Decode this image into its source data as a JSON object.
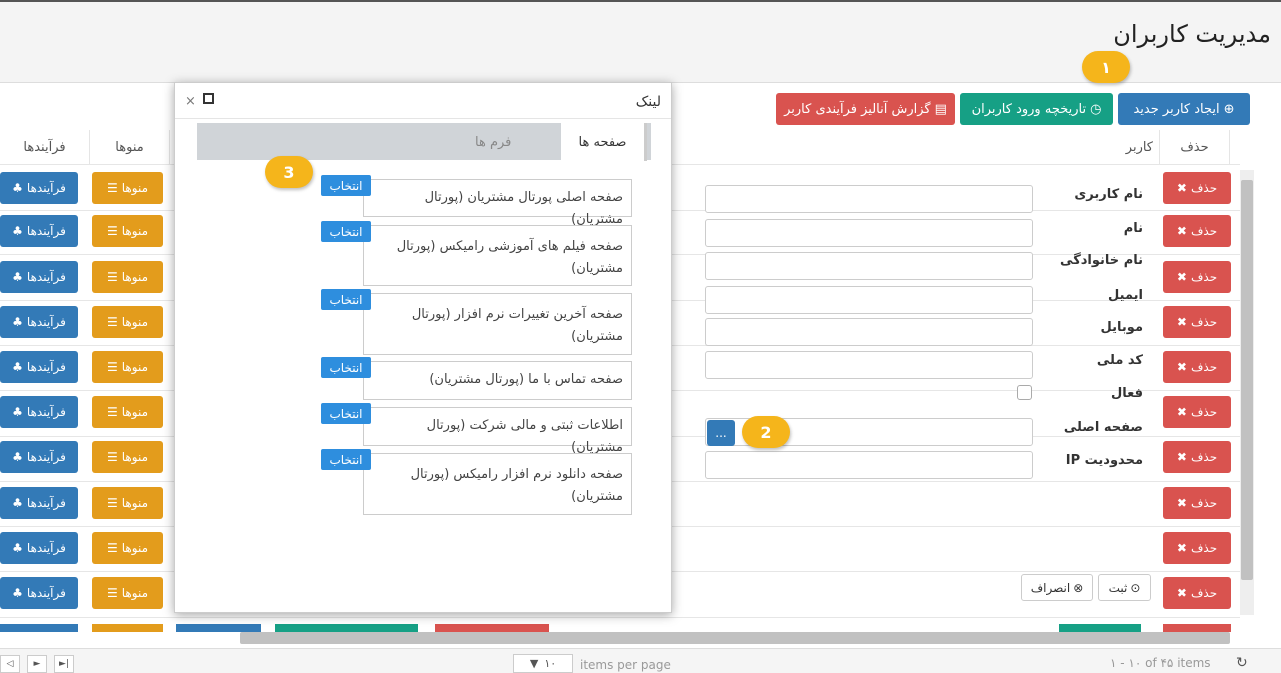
{
  "page": {
    "title": "مدیریت کاربران"
  },
  "toolbar": {
    "create_label": "ایجاد کاربر جدید",
    "history_label": "تاریخچه ورود کاربران",
    "report_label": "گزارش آنالیز فرآیندی کاربر"
  },
  "grid": {
    "headers": {
      "delete": "حذف",
      "user": "کاربر",
      "menus": "منوها",
      "processes": "فرآیندها"
    },
    "delete_label": "حذف",
    "menus_label": "منوها",
    "processes_label": "فرآیندها"
  },
  "form": {
    "username_label": "نام کاربری",
    "name_label": "نام",
    "lastname_label": "نام خانوادگی",
    "email_label": "ایمیل",
    "mobile_label": "موبایل",
    "national_code_label": "کد ملی",
    "active_label": "فعال",
    "home_page_label": "صفحه اصلی",
    "ip_limit_label": "محدودیت IP",
    "browse_label": "...",
    "save_label": "ثبت",
    "cancel_label": "انصراف"
  },
  "modal": {
    "title": "لینک",
    "tab_pages": "صفحه ها",
    "tab_forms": "فرم ها",
    "select_label": "انتخاب",
    "items": [
      {
        "label": "صفحه اصلی پورتال مشتریان (پورتال مشتریان)"
      },
      {
        "label": "صفحه فیلم های آموزشی رامیکس (پورتال مشتریان)"
      },
      {
        "label": "صفحه آخرین تغییرات نرم افزار (پورتال مشتریان)"
      },
      {
        "label": "صفحه تماس با ما (پورتال مشتریان)"
      },
      {
        "label": "اطلاعات ثبتی و مالی شرکت (پورتال مشتریان)"
      },
      {
        "label": "صفحه دانلود نرم افزار رامیکس (پورتال مشتریان)"
      }
    ]
  },
  "callouts": {
    "one": "۱",
    "two": "2",
    "three": "3"
  },
  "footer": {
    "page_size": "۱۰",
    "items_per_page": "items per page",
    "range": "۱ - ۱۰ of ۴۵ items"
  },
  "colors": {
    "blue": "#337ab7",
    "teal": "#16a085",
    "red": "#d9534f",
    "orange": "#e39c1c",
    "select_blue": "#2e8ede",
    "callout": "#f5b51b"
  }
}
